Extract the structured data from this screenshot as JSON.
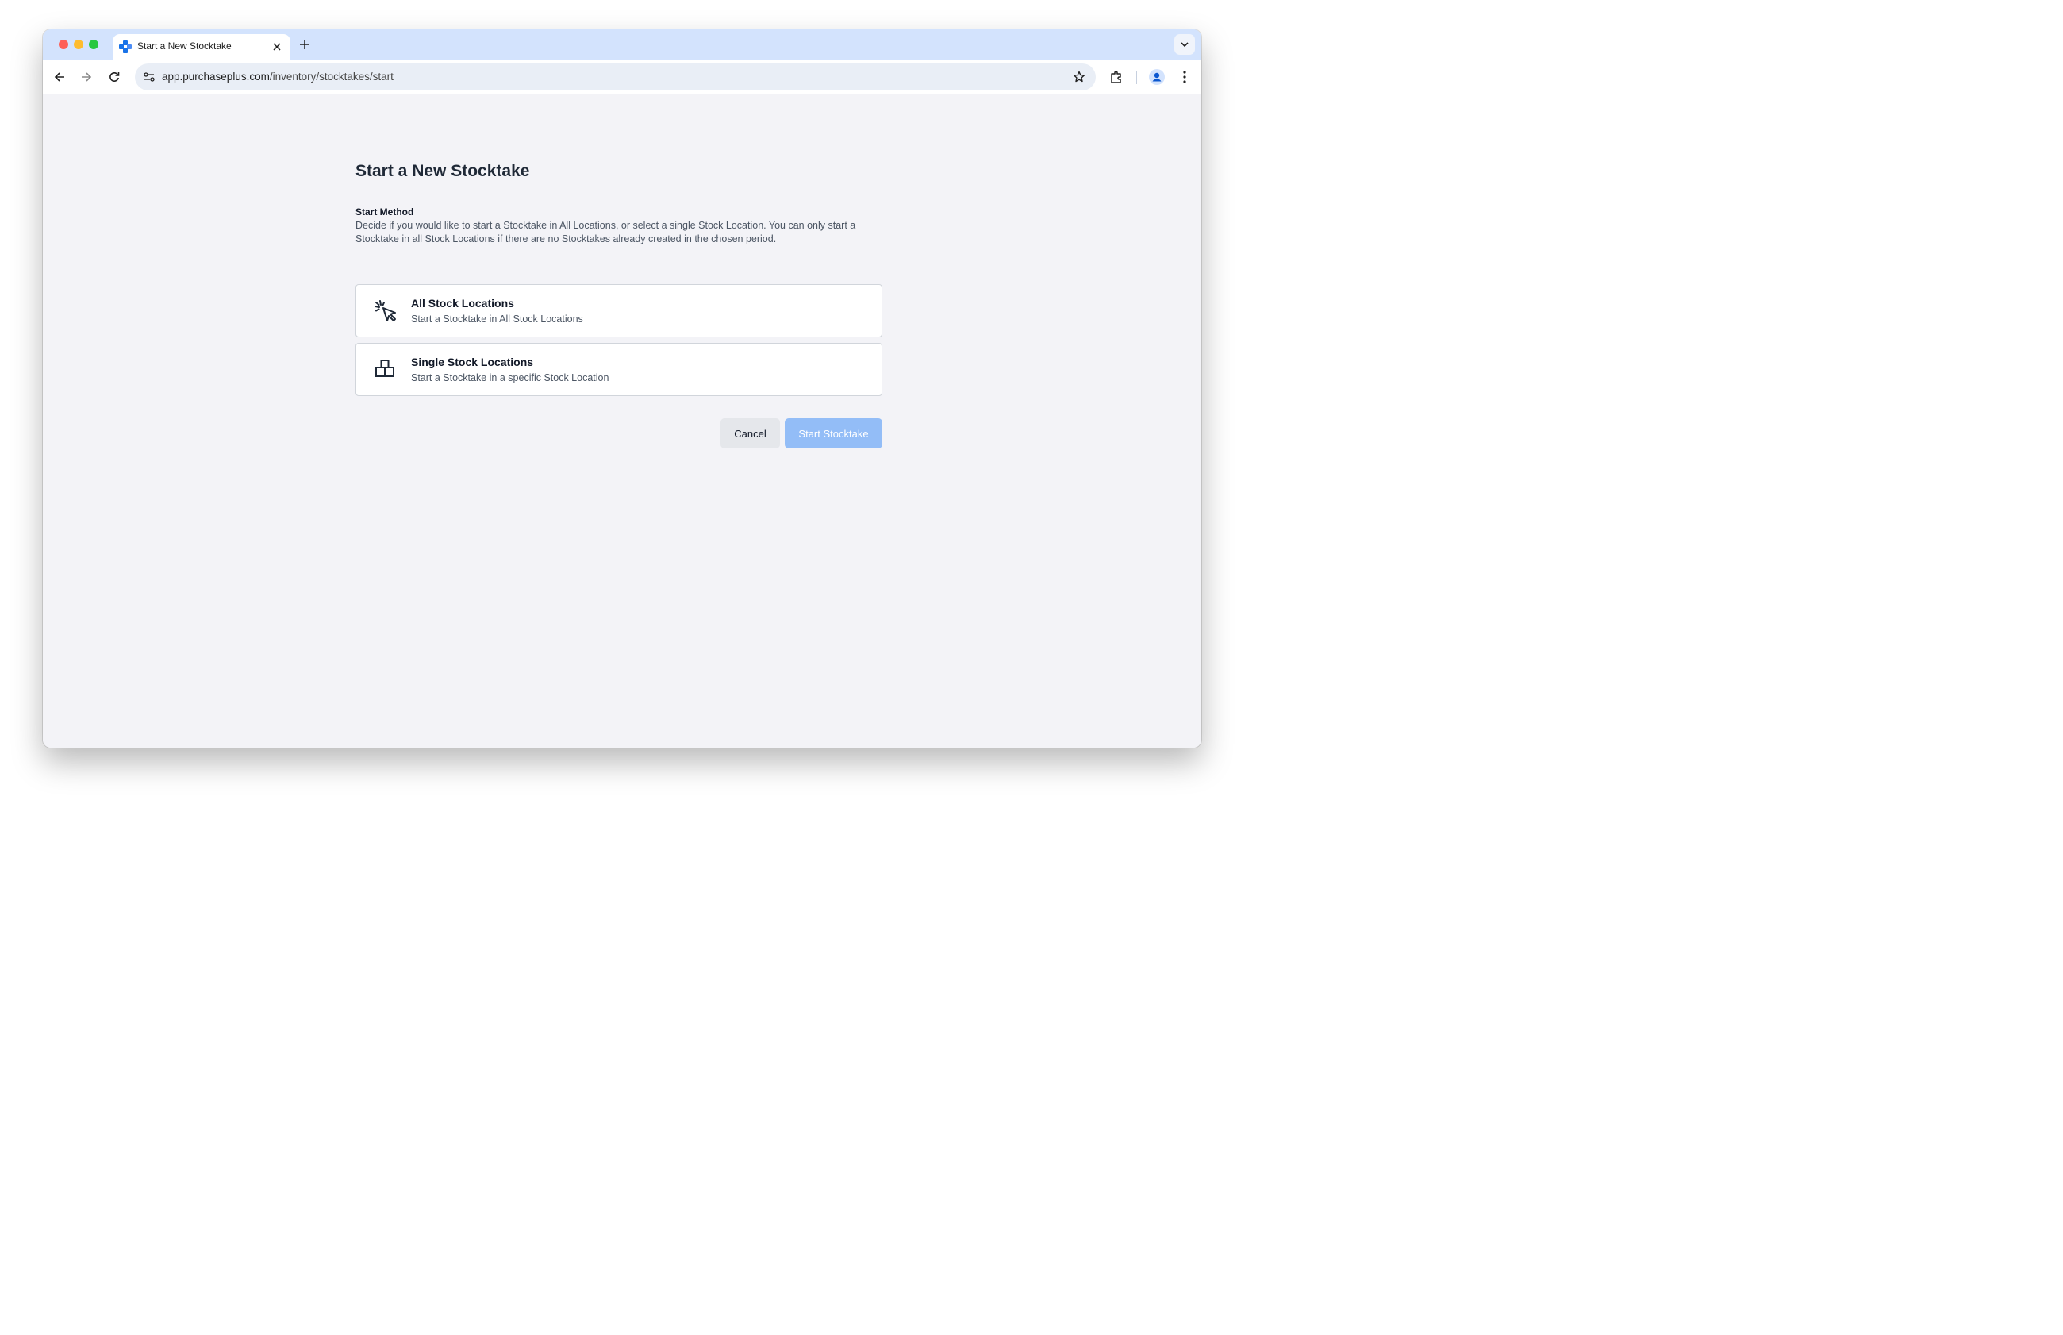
{
  "browser": {
    "tab_title": "Start a New Stocktake",
    "url_host": "app.purchaseplus.com",
    "url_path": "/inventory/stocktakes/start"
  },
  "page": {
    "title": "Start a New Stocktake",
    "section_title": "Start Method",
    "section_description": "Decide if you would like to start a Stocktake in All Locations, or select a single Stock Location. You can only start a Stocktake in all Stock Locations if there are no Stocktakes already created in the chosen period.",
    "options": [
      {
        "title": "All Stock Locations",
        "subtitle": "Start a Stocktake in All Stock Locations",
        "icon": "cursor-click-icon"
      },
      {
        "title": "Single Stock Locations",
        "subtitle": "Start a Stocktake in a specific Stock Location",
        "icon": "boxes-stack-icon"
      }
    ],
    "cancel_label": "Cancel",
    "start_label": "Start Stocktake"
  },
  "colors": {
    "primary_button_disabled": "#93bdf7",
    "tabstrip": "#d3e3fd",
    "page_background": "#f3f3f7"
  }
}
